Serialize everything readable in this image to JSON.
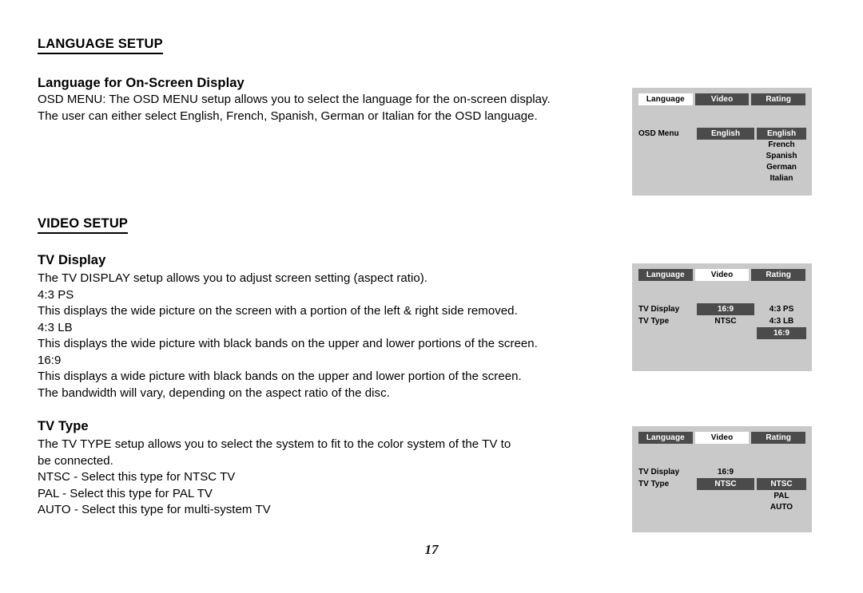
{
  "document": {
    "page_number": "17"
  },
  "sections": {
    "language_setup": {
      "heading": "LANGUAGE SETUP",
      "subheading": "Language for On-Screen Display",
      "body": [
        "OSD MENU: The OSD MENU setup allows you to select the language for the on-screen display.",
        "The user can either select English, French, Spanish, German or Italian for the OSD language."
      ]
    },
    "video_setup": {
      "heading": "VIDEO SETUP",
      "tv_display": {
        "subheading": "TV Display",
        "body": [
          "The TV DISPLAY setup allows you to adjust screen setting (aspect ratio).",
          "4:3 PS",
          "This displays the wide picture on the screen with a portion of the left & right side removed.",
          "4:3 LB",
          "This displays the wide picture with black bands on the upper and lower portions of the screen.",
          "16:9",
          "This displays a wide picture with black bands on the upper and lower portion of the screen.",
          "The bandwidth will vary, depending on the aspect ratio of the disc."
        ]
      },
      "tv_type": {
        "subheading": "TV Type",
        "body": [
          "The TV TYPE setup allows you to select the system to fit to the color system of the TV to",
          "be connected.",
          "NTSC - Select this type for NTSC TV",
          "PAL - Select this type for PAL TV",
          "AUTO - Select this type for multi-system TV"
        ]
      }
    }
  },
  "osd_panels": [
    {
      "id": "language",
      "tabs": [
        {
          "label": "Language",
          "active": true
        },
        {
          "label": "Video",
          "active": false
        },
        {
          "label": "Rating",
          "active": false
        }
      ],
      "rows": [
        {
          "label": "OSD Menu",
          "value": "English",
          "value_highlighted": true
        }
      ],
      "options": [
        {
          "label": "English",
          "highlighted": true
        },
        {
          "label": "French",
          "highlighted": false
        },
        {
          "label": "Spanish",
          "highlighted": false
        },
        {
          "label": "German",
          "highlighted": false
        },
        {
          "label": "Italian",
          "highlighted": false
        }
      ]
    },
    {
      "id": "tv-display",
      "tabs": [
        {
          "label": "Language",
          "active": false
        },
        {
          "label": "Video",
          "active": true
        },
        {
          "label": "Rating",
          "active": false
        }
      ],
      "rows": [
        {
          "label": "TV Display",
          "value": "16:9",
          "value_highlighted": true
        },
        {
          "label": "TV Type",
          "value": "NTSC",
          "value_highlighted": false
        }
      ],
      "options": [
        {
          "label": "4:3 PS",
          "highlighted": false
        },
        {
          "label": "4:3 LB",
          "highlighted": false
        },
        {
          "label": "16:9",
          "highlighted": true
        }
      ]
    },
    {
      "id": "tv-type",
      "tabs": [
        {
          "label": "Language",
          "active": false
        },
        {
          "label": "Video",
          "active": true
        },
        {
          "label": "Rating",
          "active": false
        }
      ],
      "rows": [
        {
          "label": "TV Display",
          "value": "16:9",
          "value_highlighted": false
        },
        {
          "label": "TV Type",
          "value": "NTSC",
          "value_highlighted": true
        }
      ],
      "options": [
        {
          "label": "NTSC",
          "highlighted": true
        },
        {
          "label": "PAL",
          "highlighted": false
        },
        {
          "label": "AUTO",
          "highlighted": false
        }
      ]
    }
  ],
  "colors": {
    "panel_background": "#c9c9c9",
    "highlight": "#4b4b4b",
    "active_tab": "#ffffff",
    "text": "#000000"
  }
}
